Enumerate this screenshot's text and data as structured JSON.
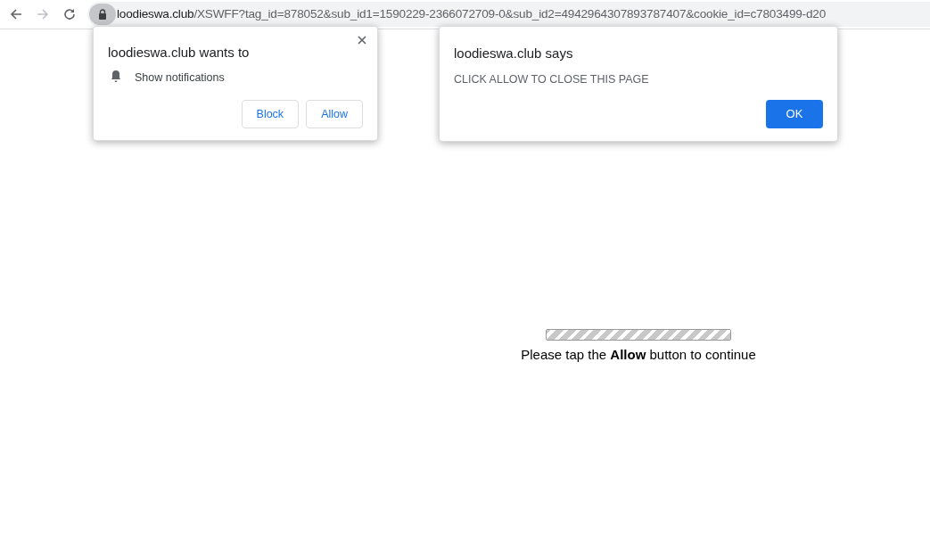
{
  "toolbar": {
    "url_host": "loodieswa.club",
    "url_path": "/XSWFF?tag_id=878052&sub_id1=1590229-2366072709-0&sub_id2=4942964307893787407&cookie_id=c7803499-d20"
  },
  "permission_popup": {
    "title": "loodieswa.club wants to",
    "permission": "Show notifications",
    "buttons": [
      "Block",
      "Allow"
    ]
  },
  "alert_dialog": {
    "title": "loodieswa.club says",
    "message": "CLICK ALLOW TO CLOSE THIS PAGE",
    "button": "OK"
  },
  "page": {
    "progress": {
      "level": 1
    },
    "message": "Please tap the **Allow** button to continue"
  }
}
